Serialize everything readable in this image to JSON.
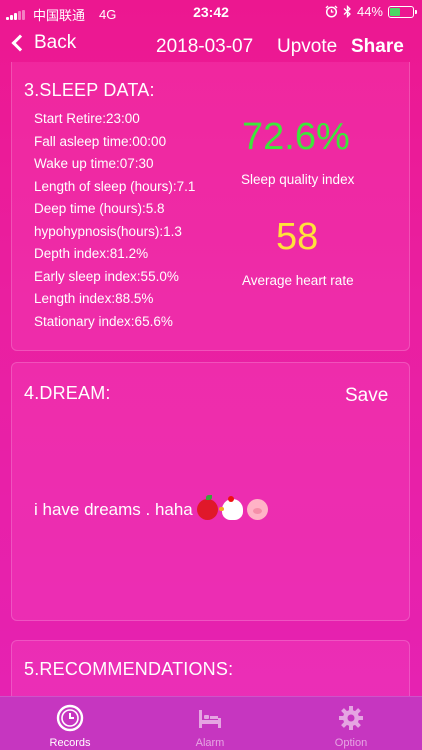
{
  "status_bar": {
    "carrier": "中国联通",
    "network": "4G",
    "time": "23:42",
    "battery_percent": "44%",
    "battery_level": 0.44,
    "icons": [
      "signal-icon",
      "alarm-icon",
      "bluetooth-icon",
      "battery-icon"
    ]
  },
  "nav": {
    "back_label": "Back",
    "date": "2018-03-07",
    "upvote_label": "Upvote",
    "share_label": "Share"
  },
  "sleep_data": {
    "title": "3.SLEEP DATA:",
    "items": [
      "Start Retire:23:00",
      "Fall asleep time:00:00",
      "Wake up time:07:30",
      "Length of sleep (hours):7.1",
      "Deep time (hours):5.8",
      "hypohypnosis(hours):1.3",
      "Depth index:81.2%",
      "Early sleep index:55.0%",
      "Length index:88.5%",
      "Stationary index:65.6%"
    ],
    "quality_value": "72.6%",
    "quality_label": "Sleep quality index",
    "heart_rate_value": "58",
    "heart_rate_label": "Average heart rate"
  },
  "dream": {
    "title": "4.DREAM:",
    "save_label": "Save",
    "text": "i have dreams . haha",
    "emojis": [
      "apple-icon",
      "chicken-icon",
      "pig-icon"
    ]
  },
  "recommendations": {
    "title": "5.RECOMMENDATIONS:"
  },
  "tabs": [
    {
      "label": "Records",
      "icon": "clock-icon",
      "active": true
    },
    {
      "label": "Alarm",
      "icon": "bed-icon",
      "active": false
    },
    {
      "label": "Option",
      "icon": "gear-icon",
      "active": false
    }
  ],
  "colors": {
    "background": "#ec1790",
    "quality": "#3ee63b",
    "heart_rate": "#ffe23a",
    "tab_bar": "#c636c0",
    "battery": "#4cd964"
  }
}
